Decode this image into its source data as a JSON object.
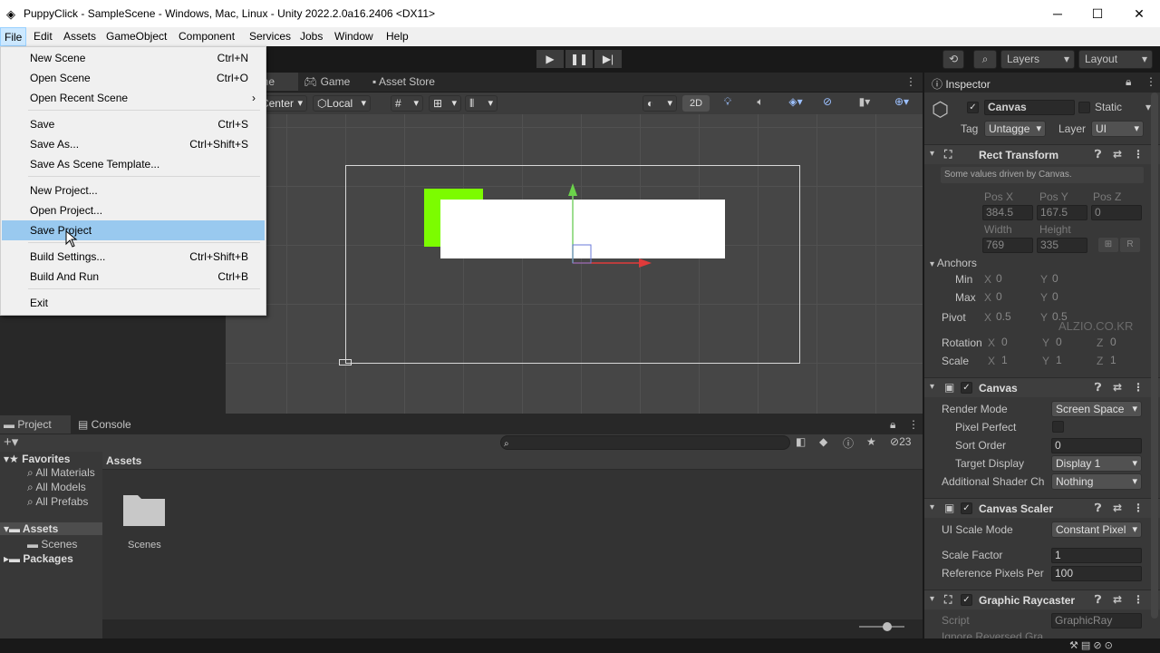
{
  "window": {
    "title": "PuppyClick - SampleScene - Windows, Mac, Linux - Unity 2022.2.0a16.2406 <DX11>"
  },
  "menubar": [
    "File",
    "Edit",
    "Assets",
    "GameObject",
    "Component",
    "Services",
    "Jobs",
    "Window",
    "Help"
  ],
  "file_menu": {
    "items": [
      {
        "label": "New Scene",
        "shortcut": "Ctrl+N"
      },
      {
        "label": "Open Scene",
        "shortcut": "Ctrl+O"
      },
      {
        "label": "Open Recent Scene",
        "shortcut": "›"
      },
      {
        "label": "Save",
        "shortcut": "Ctrl+S"
      },
      {
        "label": "Save As...",
        "shortcut": "Ctrl+Shift+S"
      },
      {
        "label": "Save As Scene Template...",
        "shortcut": ""
      },
      {
        "label": "New Project...",
        "shortcut": ""
      },
      {
        "label": "Open Project...",
        "shortcut": ""
      },
      {
        "label": "Save Project",
        "shortcut": ""
      },
      {
        "label": "Build Settings...",
        "shortcut": "Ctrl+Shift+B"
      },
      {
        "label": "Build And Run",
        "shortcut": "Ctrl+B"
      },
      {
        "label": "Exit",
        "shortcut": ""
      }
    ],
    "selected": "Save Project"
  },
  "toolbar": {
    "layers": "Layers",
    "layout": "Layout"
  },
  "scene": {
    "tabs": [
      "Scene",
      "Game",
      "Asset Store"
    ],
    "pivot": "Center",
    "space": "Local",
    "mode_2d": "2D"
  },
  "project": {
    "tabs": [
      "Project",
      "Console"
    ],
    "hidden_count": "23",
    "breadcrumb": "Assets",
    "favorites": {
      "label": "Favorites",
      "items": [
        "All Materials",
        "All Models",
        "All Prefabs"
      ]
    },
    "tree": {
      "assets": "Assets",
      "scenes": "Scenes",
      "packages": "Packages"
    },
    "folders": [
      "Scenes"
    ]
  },
  "inspector": {
    "title": "Inspector",
    "object_name": "Canvas",
    "static": "Static",
    "tag_label": "Tag",
    "tag": "Untagge",
    "layer_label": "Layer",
    "layer": "UI",
    "rect": {
      "title": "Rect Transform",
      "note": "Some values driven by Canvas.",
      "posx_l": "Pos X",
      "posy_l": "Pos Y",
      "posz_l": "Pos Z",
      "posx": "384.5",
      "posy": "167.5",
      "posz": "0",
      "width_l": "Width",
      "height_l": "Height",
      "width": "769",
      "height": "335",
      "anchors": "Anchors",
      "min": "Min",
      "max": "Max",
      "minx": "0",
      "miny": "0",
      "maxx": "0",
      "maxy": "0",
      "pivot": "Pivot",
      "pivotx": "0.5",
      "pivoty": "0.5",
      "rotation": "Rotation",
      "rotx": "0",
      "roty": "0",
      "rotz": "0",
      "scale": "Scale",
      "sx": "1",
      "sy": "1",
      "sz": "1",
      "x": "X",
      "y": "Y",
      "z": "Z",
      "r": "R"
    },
    "canvas": {
      "title": "Canvas",
      "render_mode_l": "Render Mode",
      "render_mode": "Screen Space",
      "pixel_perfect": "Pixel Perfect",
      "sort_order_l": "Sort Order",
      "sort_order": "0",
      "target_display_l": "Target Display",
      "target_display": "Display 1",
      "shader_l": "Additional Shader Ch",
      "shader": "Nothing"
    },
    "scaler": {
      "title": "Canvas Scaler",
      "mode_l": "UI Scale Mode",
      "mode": "Constant Pixel",
      "factor_l": "Scale Factor",
      "factor": "1",
      "ref_l": "Reference Pixels Per",
      "ref": "100"
    },
    "raycaster": {
      "title": "Graphic Raycaster",
      "script_l": "Script",
      "script": "GraphicRay",
      "ignore": "Ignore Reversed Gra"
    }
  },
  "watermark": "ALZIO.CO.KR"
}
